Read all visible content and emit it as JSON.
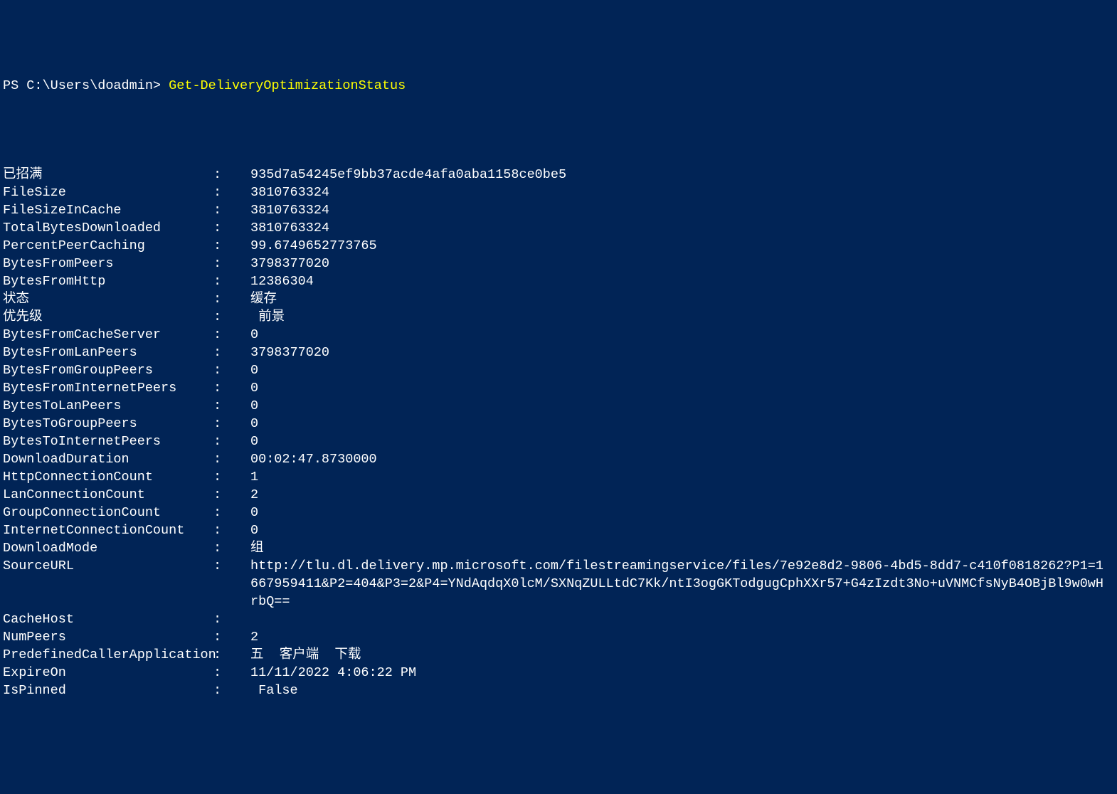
{
  "prompt": {
    "prefix": "PS C:\\Users\\doadmin> ",
    "command": "Get-DeliveryOptimizationStatus"
  },
  "fields": [
    {
      "label": "已招满",
      "value": "935d7a54245ef9bb37acde4afa0aba1158ce0be5"
    },
    {
      "label": "FileSize",
      "value": "3810763324"
    },
    {
      "label": "FileSizeInCache",
      "value": "3810763324"
    },
    {
      "label": "TotalBytesDownloaded",
      "value": "3810763324"
    },
    {
      "label": "PercentPeerCaching",
      "value": "99.6749652773765"
    },
    {
      "label": "BytesFromPeers",
      "value": "3798377020"
    },
    {
      "label": "BytesFromHttp",
      "value": "12386304"
    },
    {
      "label": "状态",
      "value": "缓存"
    },
    {
      "label": "优先级",
      "value": " 前景"
    },
    {
      "label": "BytesFromCacheServer",
      "value": "0"
    },
    {
      "label": "BytesFromLanPeers",
      "value": "3798377020"
    },
    {
      "label": "BytesFromGroupPeers",
      "value": "0"
    },
    {
      "label": "BytesFromInternetPeers",
      "value": "0"
    },
    {
      "label": "BytesToLanPeers",
      "value": "0"
    },
    {
      "label": "BytesToGroupPeers",
      "value": "0"
    },
    {
      "label": "BytesToInternetPeers",
      "value": "0"
    },
    {
      "label": "DownloadDuration",
      "value": "00:02:47.8730000"
    },
    {
      "label": "HttpConnectionCount",
      "value": "1"
    },
    {
      "label": "LanConnectionCount",
      "value": "2"
    },
    {
      "label": "GroupConnectionCount",
      "value": "0"
    },
    {
      "label": "InternetConnectionCount",
      "value": "0"
    },
    {
      "label": "DownloadMode",
      "value": "组"
    },
    {
      "label": "SourceURL",
      "value": "http://tlu.dl.delivery.mp.microsoft.com/filestreamingservice/files/7e92e8d2-9806-4bd5-8dd7-c410f0818262?P1=1667959411&P2=404&P3=2&P4=YNdAqdqX0lcM/SXNqZULLtdC7Kk/ntI3ogGKTodgugCphXXr57+G4zIzdt3No+uVNMCfsNyB4OBjBl9w0wHrbQ=="
    },
    {
      "label": "CacheHost",
      "value": ""
    },
    {
      "label": "NumPeers",
      "value": "2"
    },
    {
      "label": "PredefinedCallerApplication",
      "value": "五  客户端  下载"
    },
    {
      "label": "ExpireOn",
      "value": "11/11/2022 4:06:22 PM"
    },
    {
      "label": "IsPinned",
      "value": " False"
    }
  ]
}
